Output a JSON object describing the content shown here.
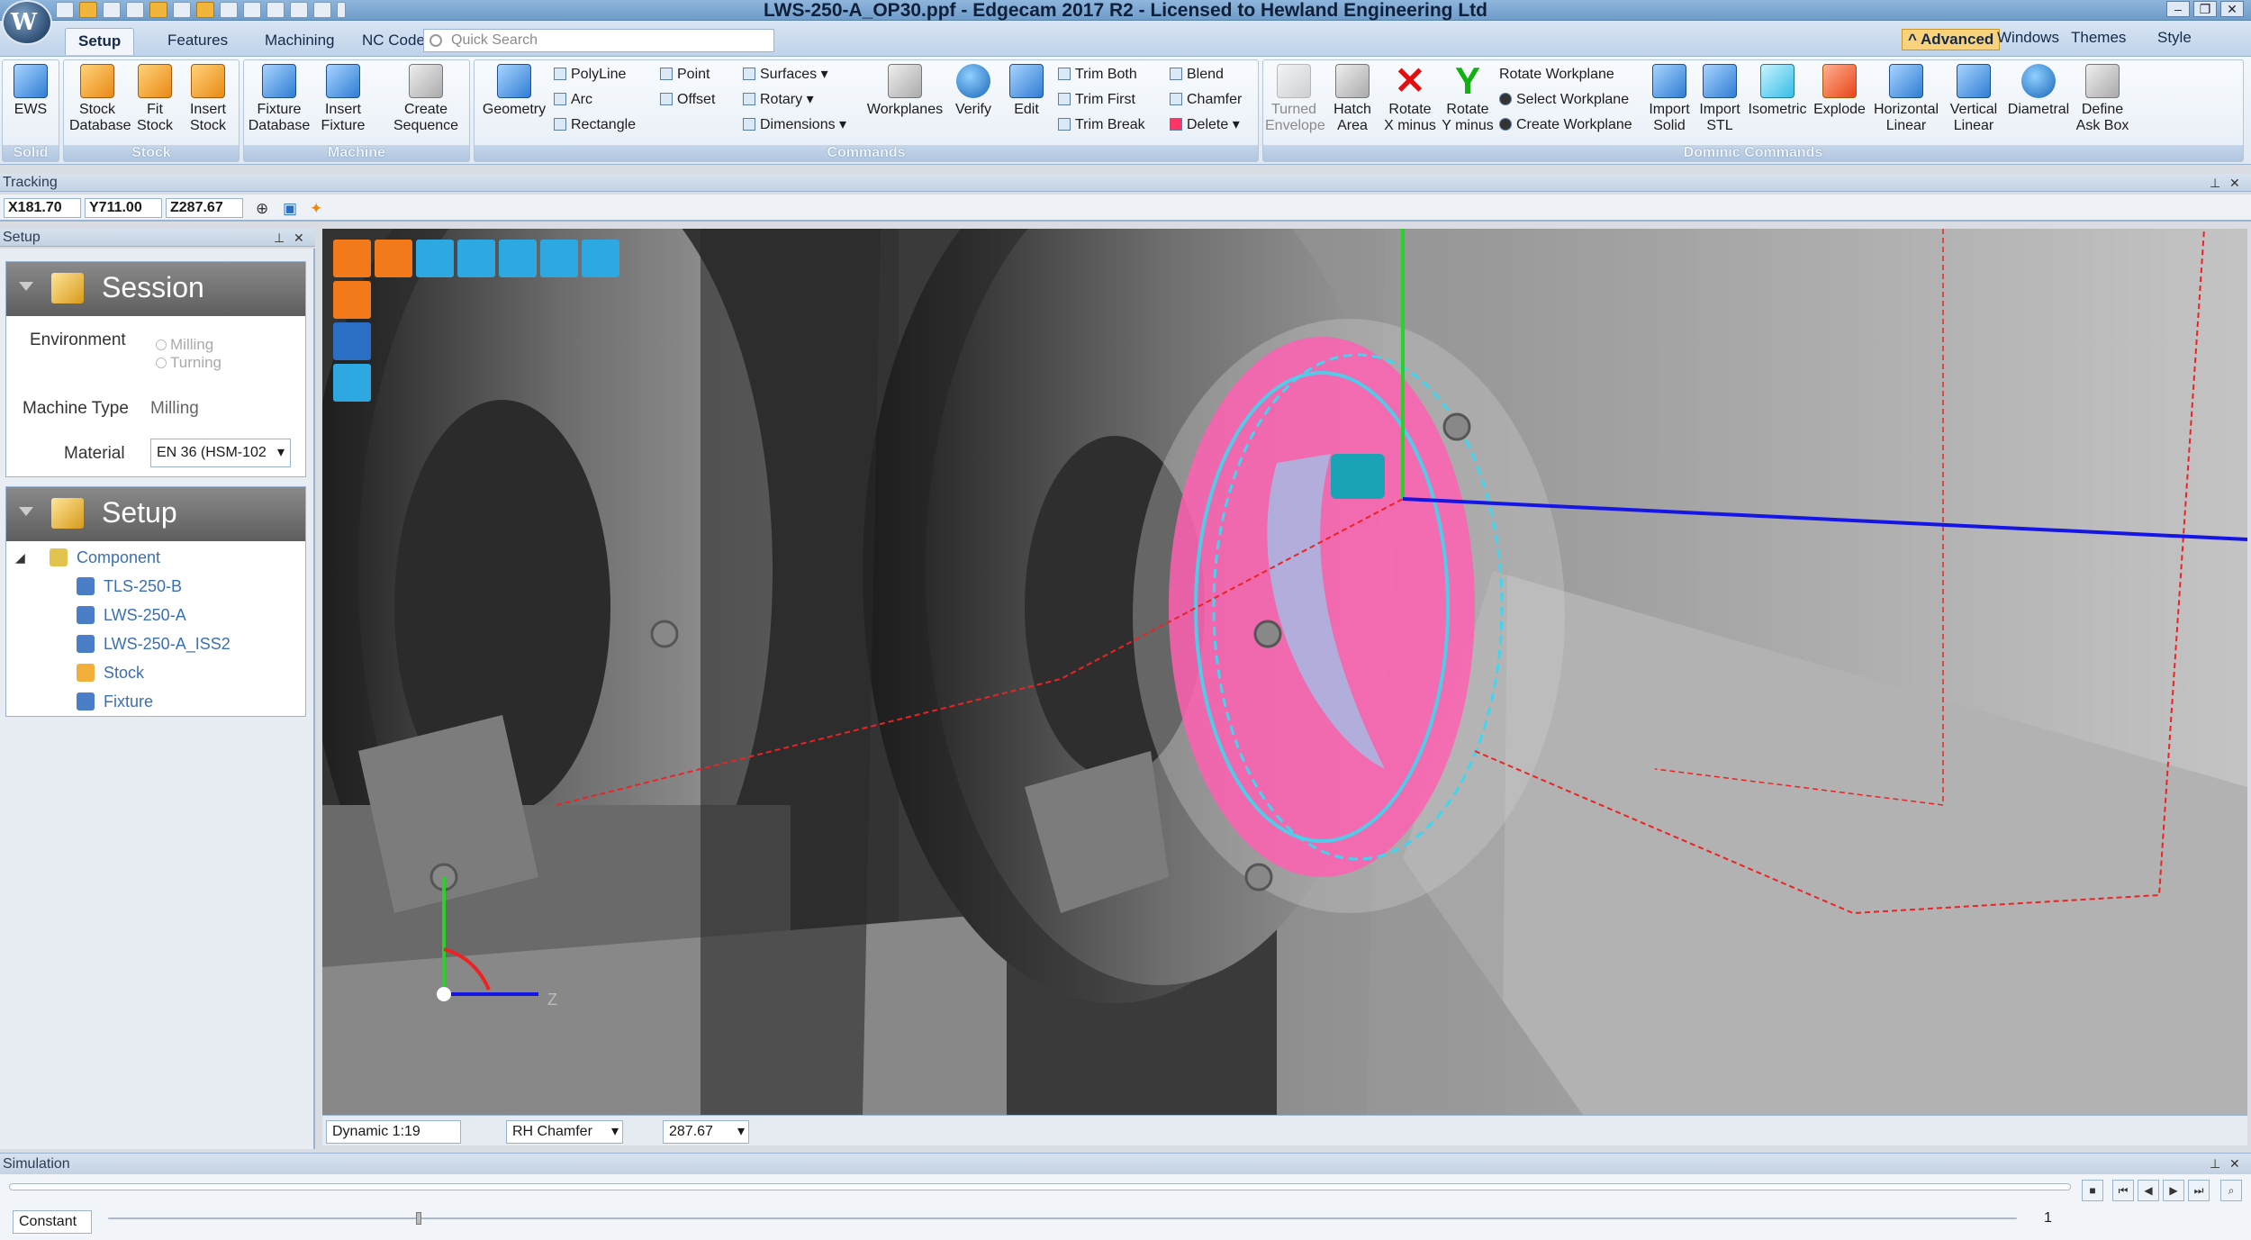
{
  "window": {
    "title": "LWS-250-A_OP30.ppf - Edgecam 2017 R2 - Licensed to Hewland Engineering Ltd"
  },
  "tabs": [
    "Setup",
    "Features",
    "Machining",
    "NC Code"
  ],
  "search": {
    "placeholder": "Quick Search"
  },
  "right_menu": {
    "advanced": "Advanced",
    "windows": "Windows",
    "themes": "Themes",
    "style": "Style"
  },
  "ribbon": {
    "groups": {
      "solid": "Solid",
      "stock": "Stock",
      "machine": "Machine",
      "commands": "Commands",
      "dominic": "Dominic Commands"
    },
    "solid": {
      "ews": "EWS"
    },
    "stock": {
      "stock_database": [
        "Stock",
        "Database"
      ],
      "fit_stock": [
        "Fit",
        "Stock"
      ],
      "insert_stock": [
        "Insert",
        "Stock"
      ]
    },
    "machine": {
      "fixture_database": [
        "Fixture",
        "Database"
      ],
      "insert_fixture": [
        "Insert",
        "Fixture"
      ],
      "create_sequence": [
        "Create",
        "Sequence"
      ]
    },
    "commands": {
      "geometry": "Geometry",
      "polyline": "PolyLine",
      "arc": "Arc",
      "rectangle": "Rectangle",
      "point": "Point",
      "offset": "Offset",
      "surfaces": "Surfaces",
      "rotary": "Rotary",
      "dimensions": "Dimensions",
      "workplanes": "Workplanes",
      "verify": "Verify",
      "edit": "Edit",
      "trim_both": "Trim Both",
      "trim_first": "Trim First",
      "trim_break": "Trim Break",
      "blend": "Blend",
      "chamfer": "Chamfer",
      "delete": "Delete"
    },
    "dominic": {
      "turned_envelope": [
        "Turned",
        "Envelope"
      ],
      "hatch_area": [
        "Hatch",
        "Area"
      ],
      "rotate_x_minus": [
        "Rotate",
        "X minus"
      ],
      "rotate_y_minus": [
        "Rotate",
        "Y minus"
      ],
      "rotate_workplane": "Rotate Workplane",
      "select_workplane": "Select Workplane",
      "create_workplane": "Create Workplane",
      "import_solid": [
        "Import",
        "Solid"
      ],
      "import_stl": [
        "Import",
        "STL"
      ],
      "isometric": "Isometric",
      "explode": "Explode",
      "horizontal_linear": [
        "Horizontal",
        "Linear"
      ],
      "vertical_linear": [
        "Vertical",
        "Linear"
      ],
      "diametral": "Diametral",
      "define_ask_box": [
        "Define",
        "Ask Box"
      ]
    }
  },
  "tracking": {
    "title": "Tracking",
    "x": "X181.70",
    "y": "Y711.00",
    "z": "Z287.67"
  },
  "setup_panel": {
    "title": "Setup",
    "session": {
      "title": "Session",
      "environment_label": "Environment",
      "env_options": [
        "Milling",
        "Turning"
      ],
      "machine_type_label": "Machine Type",
      "machine_type_value": "Milling",
      "material_label": "Material",
      "material_value": "EN 36 (HSM-102"
    },
    "setup": {
      "title": "Setup",
      "tree": [
        {
          "label": "Component"
        },
        {
          "label": "TLS-250-B"
        },
        {
          "label": "LWS-250-A"
        },
        {
          "label": "LWS-250-A_ISS2"
        },
        {
          "label": "Stock"
        },
        {
          "label": "Fixture"
        }
      ]
    }
  },
  "viewport": {
    "axis_label": "Z"
  },
  "status": {
    "mode": "Dynamic 1:19",
    "tool": "RH Chamfer",
    "depth": "287.67"
  },
  "simulation": {
    "title": "Simulation",
    "speed": "Constant",
    "step_value": "1"
  },
  "colors": {
    "accent": "#f8d37b",
    "ribbon_blue": "#9ab3cf",
    "toolpath_pink": "#ff5fb0",
    "toolpath_cyan": "#40d6f0"
  }
}
